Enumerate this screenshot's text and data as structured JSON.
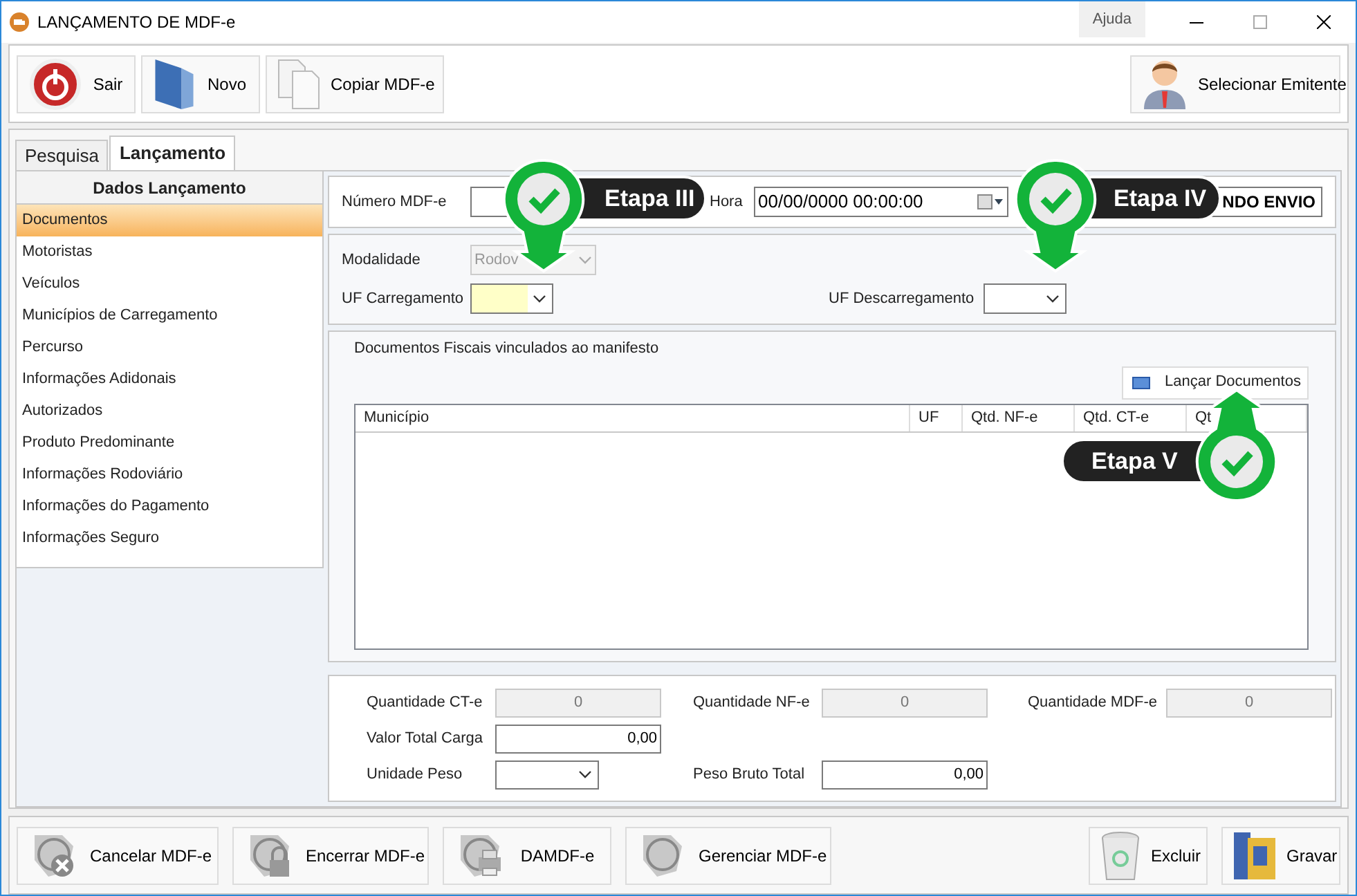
{
  "window": {
    "title": "LANÇAMENTO DE MDF-e",
    "help": "Ajuda"
  },
  "toolbar": [
    {
      "label": "Sair"
    },
    {
      "label": "Novo"
    },
    {
      "label": "Copiar MDF-e"
    }
  ],
  "toolbar_right": {
    "label": "Selecionar Emitente"
  },
  "tabs": [
    {
      "label": "Pesquisa",
      "selected": false
    },
    {
      "label": "Lançamento",
      "selected": true
    }
  ],
  "sidebar": {
    "title": "Dados Lançamento",
    "items": [
      {
        "label": "Documentos",
        "selected": true
      },
      {
        "label": "Motoristas",
        "selected": false
      },
      {
        "label": "Veículos",
        "selected": false
      },
      {
        "label": "Municípios de Carregamento",
        "selected": false
      },
      {
        "label": "Percurso",
        "selected": false
      },
      {
        "label": "Informações Adidonais",
        "selected": false
      },
      {
        "label": "Autorizados",
        "selected": false
      },
      {
        "label": "Produto Predominante",
        "selected": false
      },
      {
        "label": "Informações Rodoviário",
        "selected": false
      },
      {
        "label": "Informações do Pagamento",
        "selected": false
      },
      {
        "label": "Informações Seguro",
        "selected": false
      }
    ]
  },
  "header": {
    "number_label": "Número MDF-e",
    "date_label": "Hora",
    "date_value": "00/00/0000 00:00:00",
    "status": "NDO ENVIO"
  },
  "route": {
    "modality_label": "Modalidade",
    "modality_value": "Rodov",
    "modality_disabled": true,
    "uf_load_label": "UF Carregamento",
    "uf_load_highlighted": true,
    "uf_unload_label": "UF Descarregamento",
    "uf_unload_highlighted": false
  },
  "documents": {
    "title": "Documentos Fiscais vinculados ao manifesto",
    "button": "Lançar Documentos",
    "columns": [
      "Município",
      "UF",
      "Qtd. NF-e",
      "Qtd. CT-e",
      "Qt"
    ]
  },
  "totals": [
    {
      "label": "Quantidade CT-e",
      "value": "0",
      "kind": "readonly"
    },
    {
      "label": "Quantidade NF-e",
      "value": "0",
      "kind": "readonly"
    },
    {
      "label": "Quantidade MDF-e",
      "value": "0",
      "kind": "readonly"
    },
    {
      "label": "Valor Total Carga",
      "value": "0,00",
      "kind": "input"
    },
    {
      "label": "Unidade Peso",
      "kind": "select"
    },
    {
      "label": "Peso Bruto Total",
      "value": "0,00",
      "kind": "input"
    }
  ],
  "bottom_left": [
    {
      "label": "Cancelar MDF-e"
    },
    {
      "label": "Encerrar MDF-e"
    },
    {
      "label": "DAMDF-e"
    },
    {
      "label": "Gerenciar MDF-e"
    }
  ],
  "bottom_right": [
    {
      "label": "Excluir"
    },
    {
      "label": "Gravar"
    }
  ],
  "callouts": [
    {
      "label": "Etapa III"
    },
    {
      "label": "Etapa IV"
    },
    {
      "label": "Etapa V"
    }
  ]
}
